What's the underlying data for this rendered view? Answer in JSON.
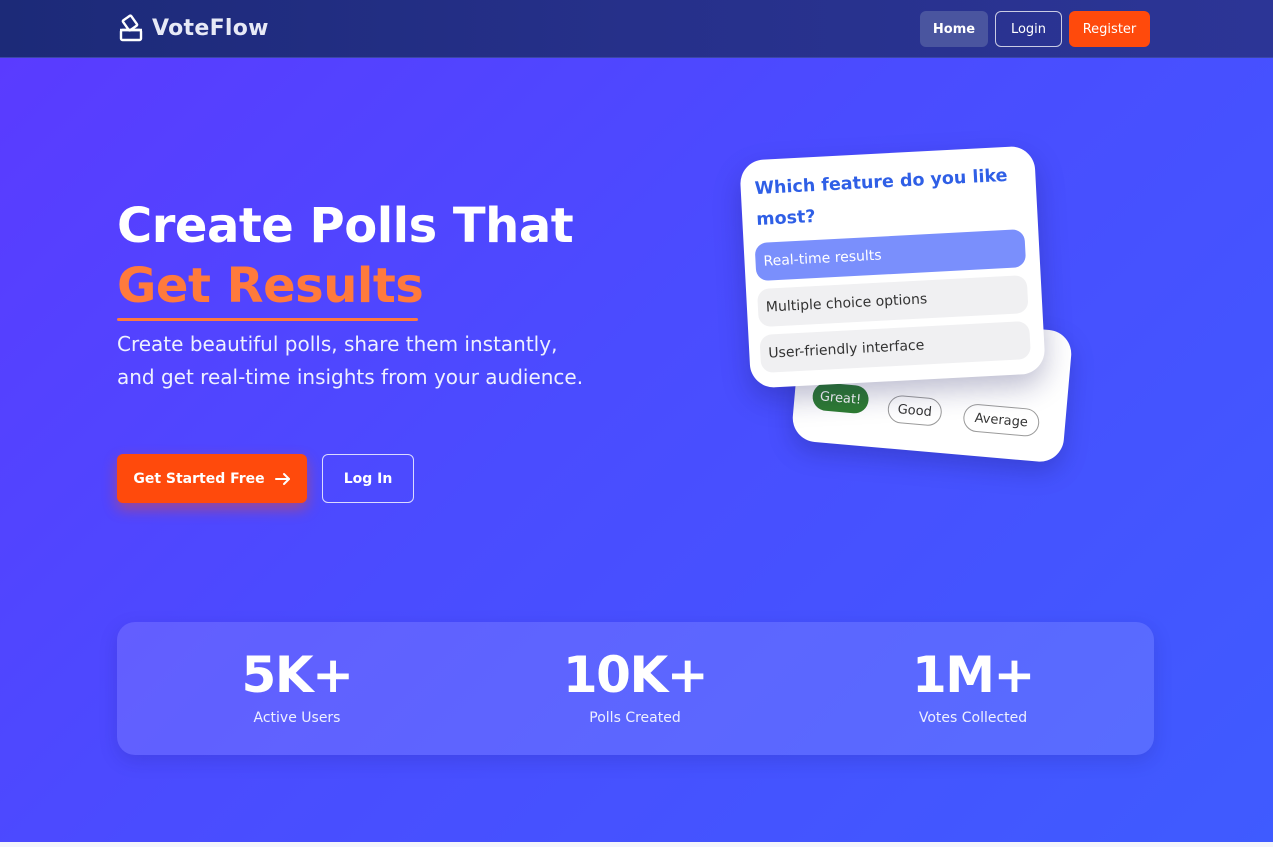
{
  "navbar": {
    "brand": "VoteFlow",
    "brand_icon": "ballot-box-icon",
    "links": {
      "home": "Home",
      "login": "Login",
      "register": "Register"
    }
  },
  "hero": {
    "title": "Create Polls That",
    "highlight": "Get Results",
    "subtitle": "Create beautiful polls, share them instantly, and get real-time insights from your audience.",
    "cta_primary": "Get Started Free",
    "cta_primary_icon": "arrow-right-icon",
    "cta_secondary": "Log In"
  },
  "poll_card": {
    "question": "Which feature do you like most?",
    "options": [
      {
        "label": "Real-time results",
        "selected": true
      },
      {
        "label": "Multiple choice options",
        "selected": false
      },
      {
        "label": "User-friendly interface",
        "selected": false
      }
    ]
  },
  "rating_card": {
    "chips": [
      "Great!",
      "Good",
      "Average"
    ]
  },
  "stats": [
    {
      "value": "5K+",
      "label": "Active Users"
    },
    {
      "value": "10K+",
      "label": "Polls Created"
    },
    {
      "value": "1M+",
      "label": "Votes Collected"
    }
  ],
  "colors": {
    "accent": "#ff4a0c",
    "highlight": "#ff7a3c",
    "primary": "#4a4cff",
    "question": "#2f5fe6",
    "selected_option": "#7a8ffc",
    "great_chip": "#2e7d32"
  }
}
